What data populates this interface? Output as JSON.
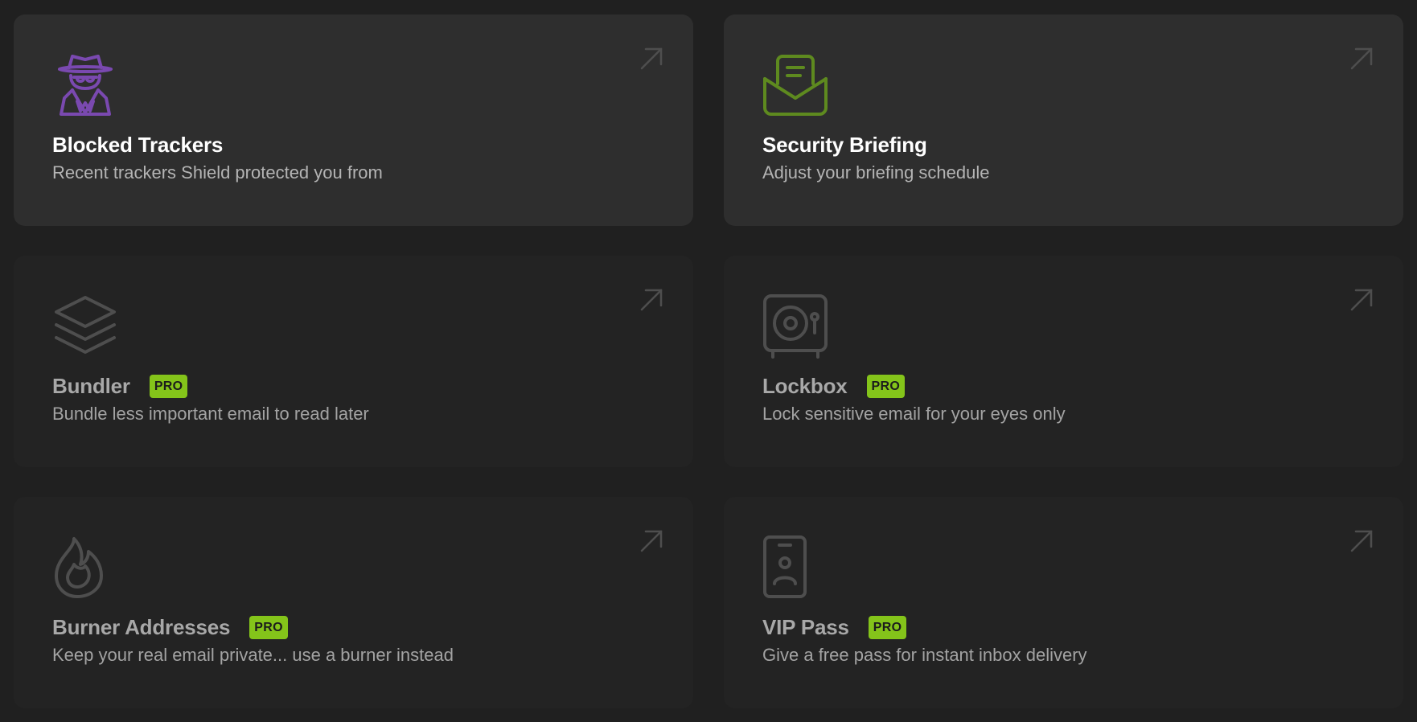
{
  "colors": {
    "background": "#202020",
    "card_active": "#2e2e2e",
    "card_inactive": "#232323",
    "badge": "#84c41a",
    "tracker_icon": "#7a49b0",
    "briefing_icon": "#5e8a1f",
    "disabled_icon": "#4e4e4e"
  },
  "cards": [
    {
      "title": "Blocked Trackers",
      "subtitle": "Recent trackers Shield protected you from",
      "icon": "spy-icon",
      "pro": false
    },
    {
      "title": "Security Briefing",
      "subtitle": "Adjust your briefing schedule",
      "icon": "envelope-letter-icon",
      "pro": false
    },
    {
      "title": "Bundler",
      "subtitle": "Bundle less important email to read later",
      "icon": "layers-icon",
      "pro": true,
      "badge": "PRO"
    },
    {
      "title": "Lockbox",
      "subtitle": "Lock sensitive email for your eyes only",
      "icon": "safe-icon",
      "pro": true,
      "badge": "PRO"
    },
    {
      "title": "Burner Addresses",
      "subtitle": "Keep your real email private... use a burner instead",
      "icon": "flame-icon",
      "pro": true,
      "badge": "PRO"
    },
    {
      "title": "VIP Pass",
      "subtitle": "Give a free pass for instant inbox delivery",
      "icon": "badge-pass-icon",
      "pro": true,
      "badge": "PRO"
    }
  ]
}
